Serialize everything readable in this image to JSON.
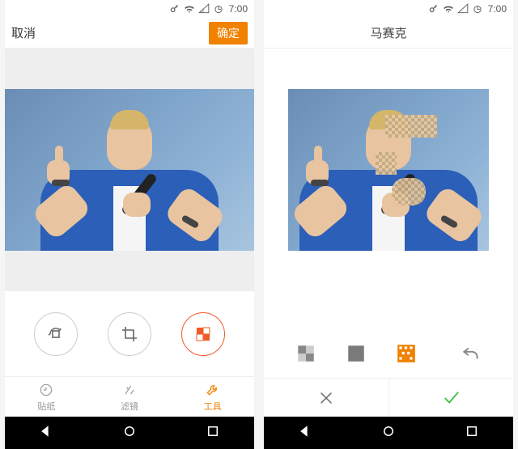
{
  "status": {
    "time": "7:00"
  },
  "left": {
    "cancel": "取消",
    "confirm": "确定",
    "tabs": [
      {
        "label": "贴纸"
      },
      {
        "label": "滤镜"
      },
      {
        "label": "工具"
      }
    ]
  },
  "right": {
    "title": "马赛克"
  },
  "colors": {
    "accent": "#f08200"
  }
}
